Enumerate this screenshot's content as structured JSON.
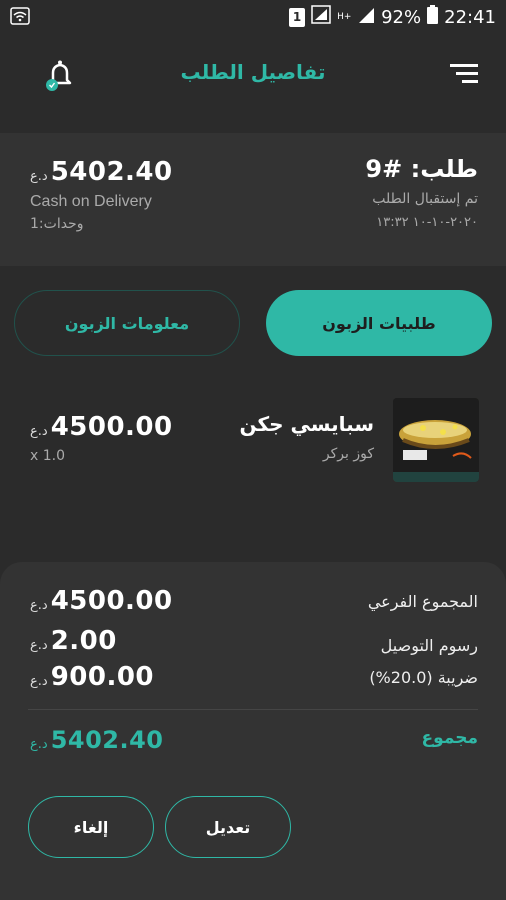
{
  "status_bar": {
    "sim_badge": "1",
    "network_label": "H+",
    "battery": "92%",
    "time": "22:41",
    "icons": [
      "wifi-icon",
      "sim-icon",
      "signal-icon",
      "battery-icon"
    ]
  },
  "header": {
    "title": "تفاصيل الطلب",
    "menu_icon": "menu-icon",
    "bell_icon": "bell-icon"
  },
  "order": {
    "number": "طلب: #9",
    "status": "تم إستقبال الطلب",
    "date": "٢٠٢٠-١٠-١٠ ١٣:٣٢",
    "total": "5402.40",
    "currency": "د.ع",
    "payment": "Cash on Delivery",
    "units": "وحدات:1"
  },
  "tabs": {
    "active": "طلبيات الزبون",
    "inactive": "معلومات الزبون"
  },
  "items": [
    {
      "name": "سبايسي جكن",
      "category": "كوز بركر",
      "price": "4500.00",
      "currency": "د.ع",
      "qty": "x 1.0"
    }
  ],
  "totals": {
    "subtotal_label": "المجموع الفرعي",
    "subtotal": "4500.00",
    "delivery_label": "رسوم التوصيل",
    "delivery": "2.00",
    "tax_label": "ضريبة (20.0%)",
    "tax": "900.00",
    "grand_label": "مجموع",
    "grand": "5402.40",
    "currency": "د.ع"
  },
  "actions": {
    "edit": "تعديل",
    "cancel": "إلغاء"
  },
  "colors": {
    "accent": "#2fb8a6",
    "background": "#2b2b2b",
    "card": "#333333"
  }
}
